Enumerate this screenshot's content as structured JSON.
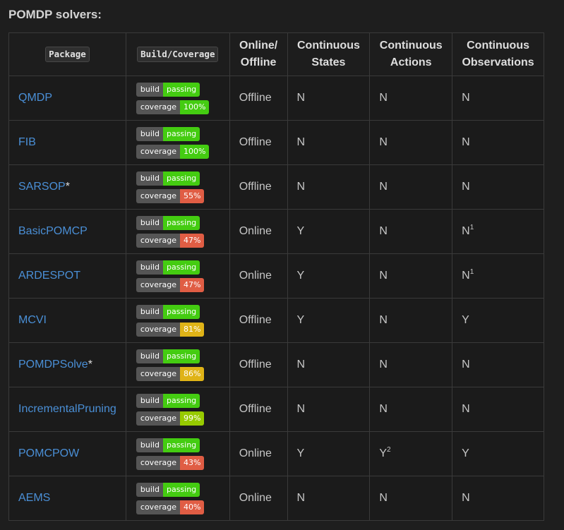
{
  "title": "POMDP solvers:",
  "headers": {
    "package": "Package",
    "build": "Build/Coverage",
    "online_l1": "Online/",
    "online_l2": "Offline",
    "cs_l1": "Continuous",
    "cs_l2": "States",
    "ca_l1": "Continuous",
    "ca_l2": "Actions",
    "co_l1": "Continuous",
    "co_l2": "Observations"
  },
  "badge_labels": {
    "build": "build",
    "coverage": "coverage"
  },
  "colors": {
    "passing": "#4c1",
    "coverage_high": "#44cc11",
    "coverage_mid_high": "#97ca00",
    "coverage_mid": "#dfb317",
    "coverage_low": "#e05d44",
    "link": "#4a8fd6"
  },
  "rows": [
    {
      "name": "QMDP",
      "star": "",
      "build": "passing",
      "coverage": "100%",
      "coverage_color": "#44cc11",
      "mode": "Offline",
      "cs": "N",
      "cs_sup": "",
      "ca": "N",
      "ca_sup": "",
      "co": "N",
      "co_sup": ""
    },
    {
      "name": "FIB",
      "star": "",
      "build": "passing",
      "coverage": "100%",
      "coverage_color": "#44cc11",
      "mode": "Offline",
      "cs": "N",
      "cs_sup": "",
      "ca": "N",
      "ca_sup": "",
      "co": "N",
      "co_sup": ""
    },
    {
      "name": "SARSOP",
      "star": "*",
      "build": "passing",
      "coverage": "55%",
      "coverage_color": "#e05d44",
      "mode": "Offline",
      "cs": "N",
      "cs_sup": "",
      "ca": "N",
      "ca_sup": "",
      "co": "N",
      "co_sup": ""
    },
    {
      "name": "BasicPOMCP",
      "star": "",
      "build": "passing",
      "coverage": "47%",
      "coverage_color": "#e05d44",
      "mode": "Online",
      "cs": "Y",
      "cs_sup": "",
      "ca": "N",
      "ca_sup": "",
      "co": "N",
      "co_sup": "1"
    },
    {
      "name": "ARDESPOT",
      "star": "",
      "build": "passing",
      "coverage": "47%",
      "coverage_color": "#e05d44",
      "mode": "Online",
      "cs": "Y",
      "cs_sup": "",
      "ca": "N",
      "ca_sup": "",
      "co": "N",
      "co_sup": "1"
    },
    {
      "name": "MCVI",
      "star": "",
      "build": "passing",
      "coverage": "81%",
      "coverage_color": "#dfb317",
      "mode": "Offline",
      "cs": "Y",
      "cs_sup": "",
      "ca": "N",
      "ca_sup": "",
      "co": "Y",
      "co_sup": ""
    },
    {
      "name": "POMDPSolve",
      "star": "*",
      "build": "passing",
      "coverage": "86%",
      "coverage_color": "#dfb317",
      "mode": "Offline",
      "cs": "N",
      "cs_sup": "",
      "ca": "N",
      "ca_sup": "",
      "co": "N",
      "co_sup": ""
    },
    {
      "name": "IncrementalPruning",
      "star": "",
      "build": "passing",
      "coverage": "99%",
      "coverage_color": "#97ca00",
      "mode": "Offline",
      "cs": "N",
      "cs_sup": "",
      "ca": "N",
      "ca_sup": "",
      "co": "N",
      "co_sup": ""
    },
    {
      "name": "POMCPOW",
      "star": "",
      "build": "passing",
      "coverage": "43%",
      "coverage_color": "#e05d44",
      "mode": "Online",
      "cs": "Y",
      "cs_sup": "",
      "ca": "Y",
      "ca_sup": "2",
      "co": "Y",
      "co_sup": ""
    },
    {
      "name": "AEMS",
      "star": "",
      "build": "passing",
      "coverage": "40%",
      "coverage_color": "#e05d44",
      "mode": "Online",
      "cs": "N",
      "cs_sup": "",
      "ca": "N",
      "ca_sup": "",
      "co": "N",
      "co_sup": ""
    }
  ]
}
